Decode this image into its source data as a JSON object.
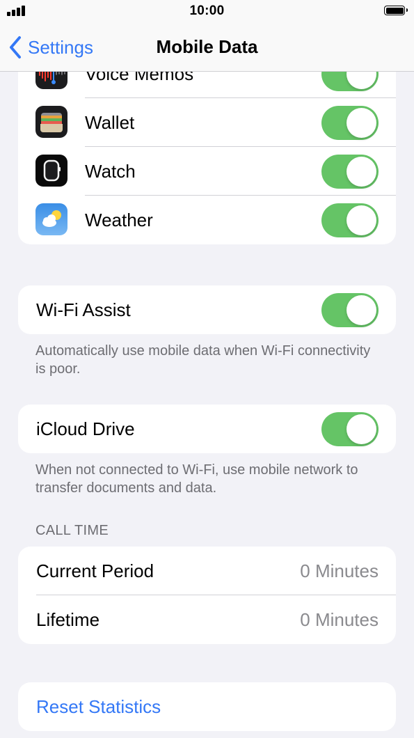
{
  "status_bar": {
    "time": "10:00"
  },
  "nav": {
    "back_label": "Settings",
    "title": "Mobile Data"
  },
  "apps": [
    {
      "label": "Voice Memos",
      "icon": "voice-memos-icon",
      "enabled": true
    },
    {
      "label": "Wallet",
      "icon": "wallet-icon",
      "enabled": true
    },
    {
      "label": "Watch",
      "icon": "watch-icon",
      "enabled": true
    },
    {
      "label": "Weather",
      "icon": "weather-icon",
      "enabled": true
    }
  ],
  "wifi_assist": {
    "label": "Wi-Fi Assist",
    "enabled": true,
    "footnote": "Automatically use mobile data when Wi-Fi connectivity is poor."
  },
  "icloud_drive": {
    "label": "iCloud Drive",
    "enabled": true,
    "footnote": "When not connected to Wi-Fi, use mobile network to transfer documents and data."
  },
  "call_time": {
    "header": "CALL TIME",
    "rows": [
      {
        "label": "Current Period",
        "value": "0 Minutes"
      },
      {
        "label": "Lifetime",
        "value": "0 Minutes"
      }
    ]
  },
  "reset": {
    "label": "Reset Statistics"
  },
  "colors": {
    "accent": "#3478f6",
    "toggle_on": "#65c466",
    "background": "#f2f2f7"
  }
}
